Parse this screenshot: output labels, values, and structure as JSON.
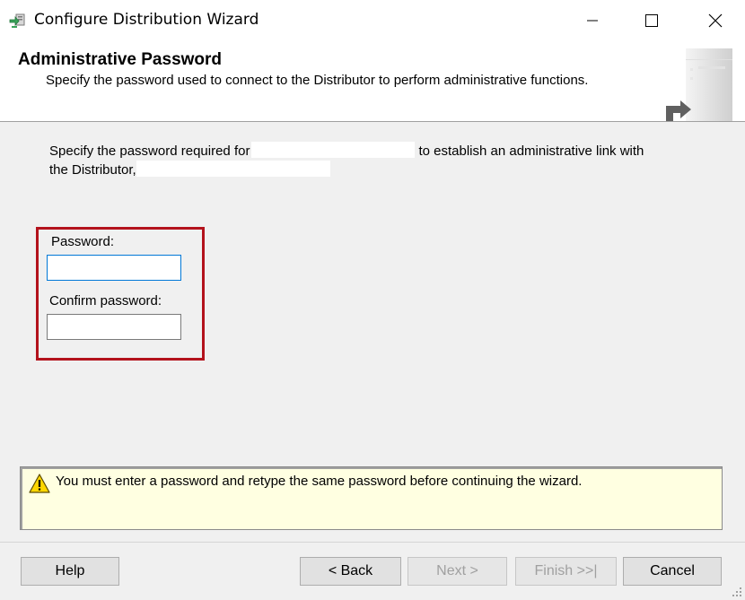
{
  "window": {
    "title": "Configure Distribution Wizard",
    "icon": "wizard-icon",
    "controls": [
      "minimize-icon",
      "maximize-icon",
      "close-icon"
    ]
  },
  "header": {
    "title": "Administrative Password",
    "subtitle": "Specify the password used to connect to the Distributor to perform administrative functions."
  },
  "description": {
    "part1": "Specify the password required for",
    "part2": "to establish an administrative link with",
    "part3": "the Distributor,"
  },
  "fields": {
    "password_label": "Password:",
    "password_value": "",
    "confirm_label": "Confirm password:",
    "confirm_value": ""
  },
  "message": {
    "icon": "warning-icon",
    "text": "You must enter a password and retype the same password before continuing the wizard."
  },
  "buttons": {
    "help": "Help",
    "back": "< Back",
    "next": "Next >",
    "finish": "Finish >>|",
    "cancel": "Cancel"
  },
  "colors": {
    "highlight": "#b3121c",
    "message_bg": "#ffffe1",
    "focus_border": "#0078d7"
  }
}
